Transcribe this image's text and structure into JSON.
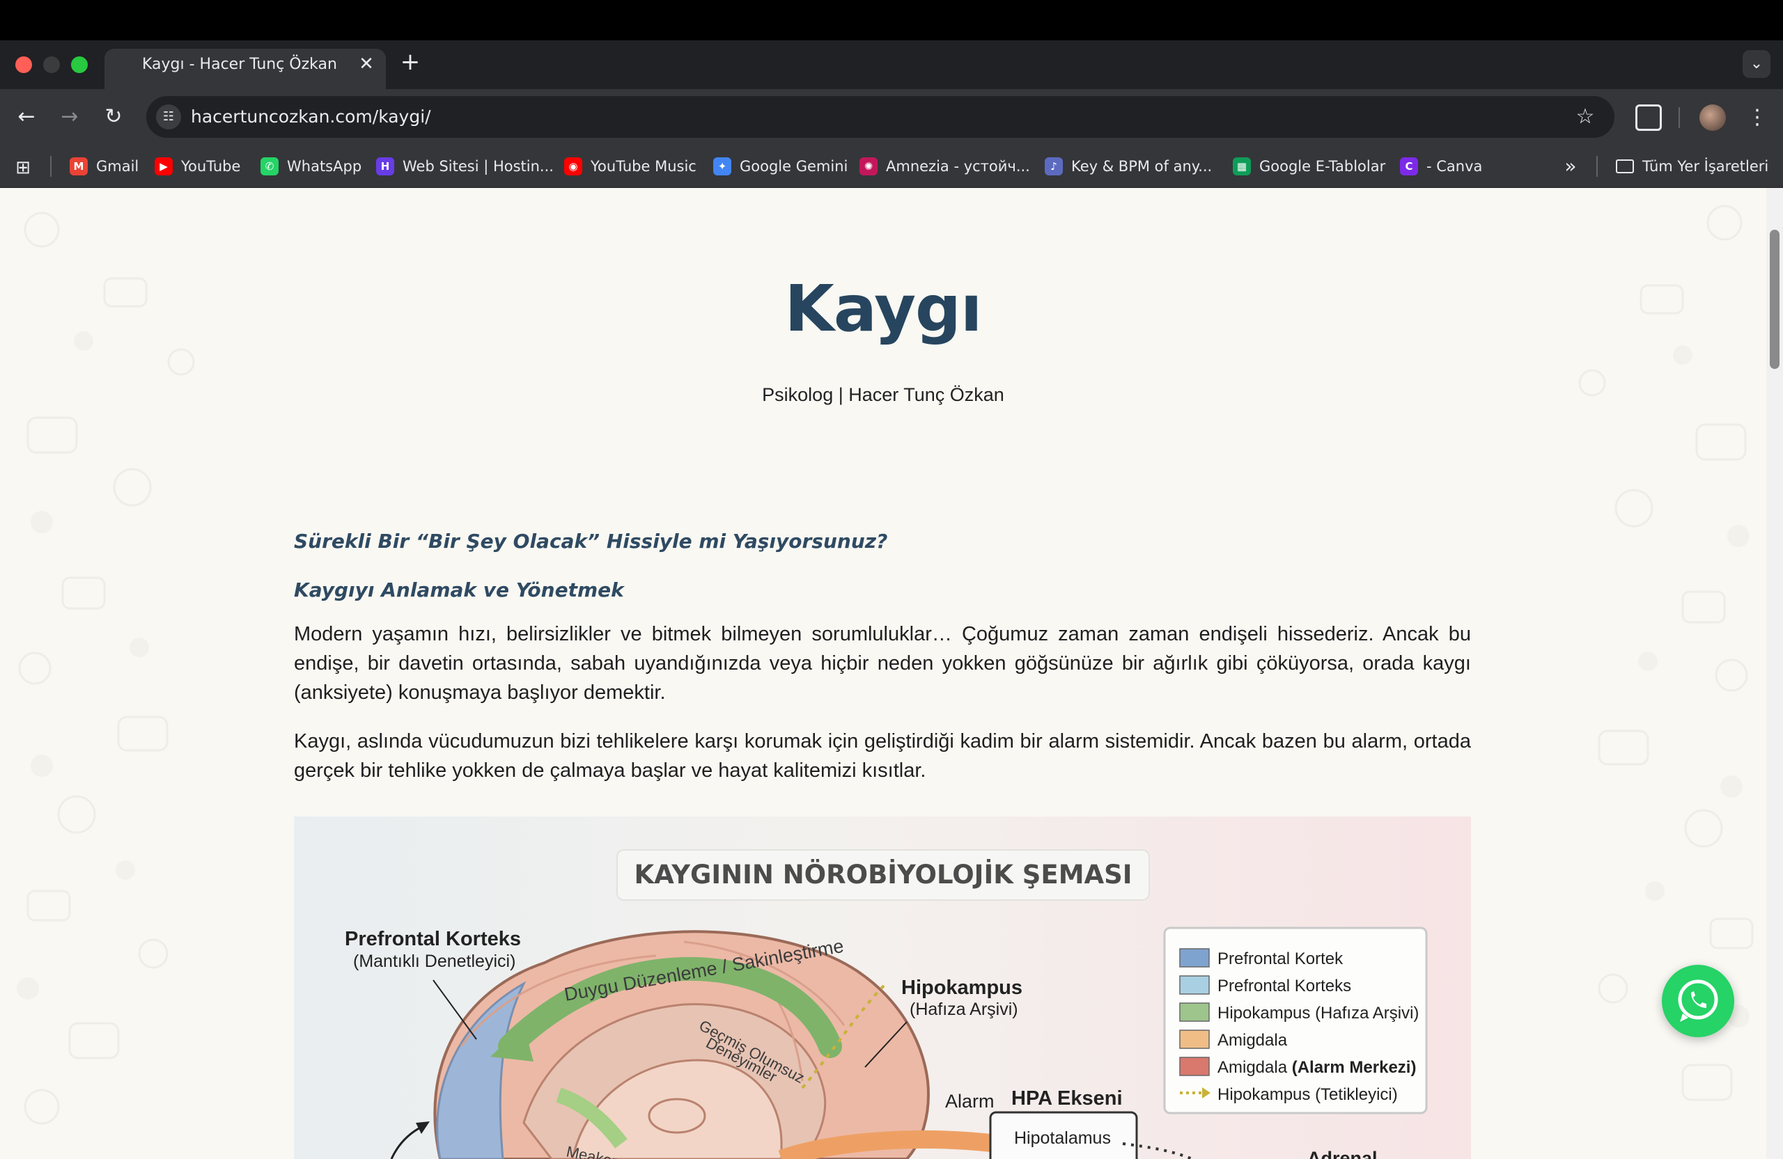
{
  "browser": {
    "tab_title": "Kaygı - Hacer Tunç Özkan",
    "tab_close": "✕",
    "new_tab": "+",
    "url": "hacertuncozkan.com/kaygi/",
    "bookmarks": [
      {
        "label": "Gmail",
        "icon": "gmail-icon",
        "color": "#ea4335",
        "glyph": "M"
      },
      {
        "label": "YouTube",
        "icon": "youtube-icon",
        "color": "#ff0000",
        "glyph": "▶"
      },
      {
        "label": "WhatsApp",
        "icon": "whatsapp-icon",
        "color": "#25d366",
        "glyph": "✆"
      },
      {
        "label": "Web Sitesi | Hostin...",
        "icon": "hostinger-icon",
        "color": "#673de6",
        "glyph": "H"
      },
      {
        "label": "YouTube Music",
        "icon": "youtube-music-icon",
        "color": "#ff0000",
        "glyph": "◉"
      },
      {
        "label": "Google Gemini",
        "icon": "gemini-icon",
        "color": "#4285f4",
        "glyph": "✦"
      },
      {
        "label": "Amnezia - устойч...",
        "icon": "amnezia-icon",
        "color": "#c2185b",
        "glyph": "✺"
      },
      {
        "label": "Key & BPM of any...",
        "icon": "tunebat-icon",
        "color": "#5c6bc0",
        "glyph": "♪"
      },
      {
        "label": "Google E-Tablolar",
        "icon": "google-sheets-icon",
        "color": "#0f9d58",
        "glyph": "▦"
      },
      {
        "label": "- Canva",
        "icon": "canva-icon",
        "color": "#7d2ae8",
        "glyph": "C"
      }
    ],
    "bookmarks_more": "»",
    "all_bookmarks": "Tüm Yer İşaretleri"
  },
  "page": {
    "title": "Kaygı",
    "subtitle": "Psikolog | Hacer Tunç Özkan",
    "heading1": "Sürekli Bir “Bir Şey Olacak” Hissiyle mi Yaşıyorsunuz?",
    "heading2": "Kaygıyı Anlamak ve Yönetmek",
    "paragraph1": "Modern yaşamın hızı, belirsizlikler ve bitmek bilmeyen sorumluluklar… Çoğumuz zaman zaman endişeli hissederiz. Ancak bu endişe, bir davetin ortasında, sabah uyandığınızda veya hiçbir neden yokken göğsünüze bir ağırlık gibi çöküyorsa, orada kaygı (anksiyete) konuşmaya başlıyor demektir.",
    "paragraph2": "Kaygı, aslında vücudumuzun bizi tehlikelere karşı korumak için geliştirdiği kadim bir alarm sistemidir. Ancak bazen bu alarm, ortada gerçek bir tehlike yokken de çalmaya başlar ve hayat kalitemizi kısıtlar."
  },
  "figure": {
    "title": "KAYGININ NÖROBİYOLOJİK ŞEMASI",
    "pfc_label": "Prefrontal Korteks",
    "pfc_sub": "(Mantıklı Denetleyici)",
    "arc_text": "Duygu Düzenleme / Sakinleştirme",
    "past_text_1": "Geçmiş Olumsuz",
    "past_text_2": "Deneyimler",
    "hippo_label": "Hipokampus",
    "hippo_sub": "(Hafıza Arşivi)",
    "alarm": "Alarm",
    "hpa": "HPA Ekseni",
    "hypothalamus": "Hipotalamus",
    "adrenal": "Adrenal",
    "meaker": "Meaker",
    "legend": [
      {
        "text": "Prefrontal Kortek",
        "bold": "",
        "color": "#7fa3cf"
      },
      {
        "text": "Prefrontal Korteks",
        "bold": "",
        "color": "#a9d0e2"
      },
      {
        "text": "Hipokampus (Hafıza Arşivi)",
        "bold": "",
        "color": "#9dc58c"
      },
      {
        "text": "Amigdala",
        "bold": "",
        "color": "#f0bd86"
      },
      {
        "text": "Amigdala ",
        "bold": "(Alarm Merkezi)",
        "color": "#d9786d"
      },
      {
        "text": "Hipokampus (Tetikleyici)",
        "bold": "",
        "color": "#c9b23a"
      }
    ]
  }
}
